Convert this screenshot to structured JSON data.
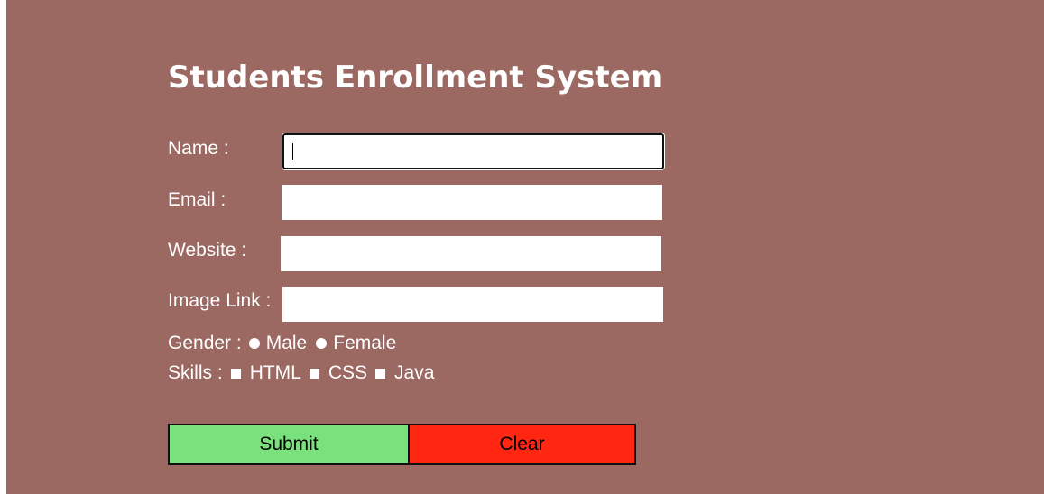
{
  "form": {
    "title": "Students Enrollment System",
    "fields": {
      "name": {
        "label": "Name :",
        "value": ""
      },
      "email": {
        "label": "Email :",
        "value": ""
      },
      "website": {
        "label": "Website :",
        "value": ""
      },
      "image_link": {
        "label": "Image Link :",
        "value": ""
      }
    },
    "gender": {
      "label": "Gender :",
      "options": [
        "Male",
        "Female"
      ]
    },
    "skills": {
      "label": "Skills :",
      "options": [
        "HTML",
        "CSS",
        "Java"
      ]
    },
    "buttons": {
      "submit": "Submit",
      "clear": "Clear"
    }
  },
  "colors": {
    "background": "#9b6862",
    "submit": "#7ae27c",
    "clear": "#ff2612"
  }
}
